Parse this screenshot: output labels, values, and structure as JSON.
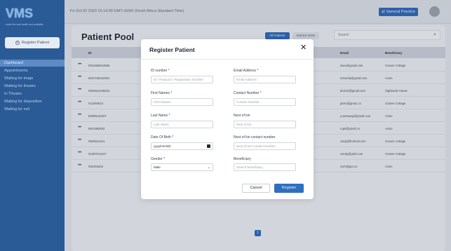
{
  "app": {
    "logo": "VMS",
    "logo_subtitle": "make the wait health and available",
    "register_button": "Register Patient"
  },
  "sidebar": {
    "items": [
      {
        "label": "Dashboard",
        "active": true
      },
      {
        "label": "Appointments",
        "active": false
      },
      {
        "label": "Waiting for triage",
        "active": false
      },
      {
        "label": "Waiting for theatre",
        "active": false
      },
      {
        "label": "In Theatre",
        "active": false
      },
      {
        "label": "Waiting for disposition",
        "active": false
      },
      {
        "label": "Waiting for exit",
        "active": false
      }
    ]
  },
  "topbar": {
    "date": "Fri Oct 02 2020 15:14:00 GMT+0200 (South Africa Standard Time)",
    "practice_button": "General Practice"
  },
  "pool": {
    "title": "Patient Pool",
    "tabs": [
      "All Patients",
      "Started Visits"
    ],
    "search_placeholder": "Search",
    "columns": [
      "ID",
      "Email",
      "Beneficiary"
    ],
    "rows": [
      {
        "actions": "•••",
        "id": "0924959034956",
        "email": "dave@gmail.com",
        "beneficiary": "Craven Cottage"
      },
      {
        "actions": "•••",
        "id": "8347235192391",
        "email": "miranda@gmail.com",
        "beneficiary": "Avion"
      },
      {
        "actions": "•••",
        "id": "0923812349234",
        "email": "derrick@gmail.com",
        "beneficiary": "Highlands House"
      },
      {
        "actions": "•••",
        "id": "012384013",
        "email": "jacko@gmac.co",
        "beneficiary": "Craven Cottage"
      },
      {
        "actions": "•••",
        "id": "82095140207",
        "email": "j.vanraway@gmail.com",
        "beneficiary": "Avion"
      },
      {
        "actions": "•••",
        "id": "9841983452",
        "email": "rups@gmail.co",
        "beneficiary": "Avion"
      },
      {
        "actions": "•••",
        "id": "0923841341",
        "email": "cindy@hotmail.com",
        "beneficiary": "Craven Cottage"
      },
      {
        "actions": "•••",
        "id": "01307013317",
        "email": "candy@gmil.com",
        "beneficiary": "Craven Cottage"
      },
      {
        "actions": "•••",
        "id": "092452533",
        "email": "mich@gm.co",
        "beneficiary": "Avion"
      }
    ],
    "page": "1"
  },
  "modal": {
    "title": "Register Patient",
    "fields": {
      "id_number": {
        "label": "ID number *",
        "placeholder": "ID / Passport / Registration Number"
      },
      "email": {
        "label": "Email Address *",
        "placeholder": "Email Address"
      },
      "first_names": {
        "label": "First Names *",
        "placeholder": "First Names"
      },
      "contact": {
        "label": "Contact Number *",
        "placeholder": "Contact Number"
      },
      "last_name": {
        "label": "Last Name *",
        "placeholder": "Last Name"
      },
      "next_of_kin": {
        "label": "Next of kin",
        "placeholder": "Next of kin"
      },
      "dob": {
        "label": "Date Of Birth *",
        "value": "yyyy/mm/dd"
      },
      "kin_contact": {
        "label": "Next of kin contact number",
        "placeholder": "Next of Kin Contact Number"
      },
      "gender": {
        "label": "Gender *",
        "value": "Male"
      },
      "beneficiary": {
        "label": "Beneficiary",
        "placeholder": "Search beneficiary..."
      }
    },
    "cancel": "Cancel",
    "submit": "Register"
  }
}
